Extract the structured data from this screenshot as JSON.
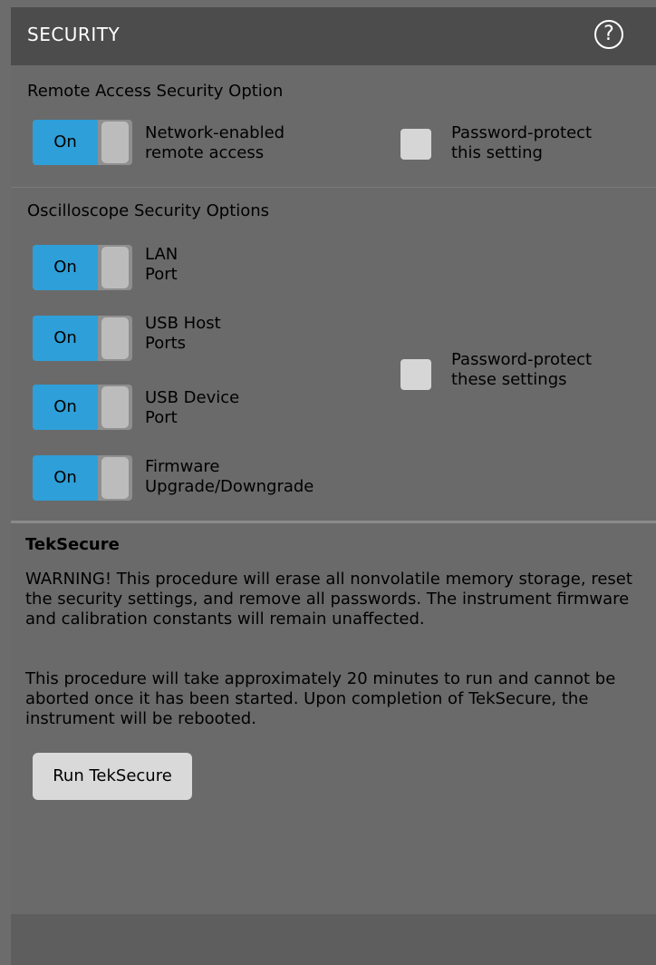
{
  "header": {
    "title": "SECURITY",
    "help_icon": "help-icon"
  },
  "remote": {
    "title": "Remote Access Security Option",
    "toggle_state": "On",
    "toggle_label": "Network-enabled\nremote access",
    "checkbox_label": "Password-protect\nthis setting"
  },
  "scope": {
    "title": "Oscilloscope Security Options",
    "toggles": [
      {
        "state": "On",
        "label": "LAN\nPort"
      },
      {
        "state": "On",
        "label": "USB Host\nPorts"
      },
      {
        "state": "On",
        "label": "USB Device\nPort"
      },
      {
        "state": "On",
        "label": "Firmware\nUpgrade/Downgrade"
      }
    ],
    "checkbox_label": "Password-protect\nthese settings"
  },
  "teksecure": {
    "title": "TekSecure",
    "warning": "WARNING! This procedure will erase all nonvolatile memory storage, reset the security settings, and remove all passwords. The instrument firmware and calibration constants will remain unaffected.",
    "info": "This procedure will take approximately 20 minutes to run and cannot be aborted once it has been started. Upon completion of TekSecure, the instrument will be rebooted.",
    "button_label": "Run TekSecure"
  },
  "colors": {
    "toggle_on": "#2e9fd8",
    "header_bg": "#4c4c4c",
    "panel_bg": "#6a6a6a"
  }
}
